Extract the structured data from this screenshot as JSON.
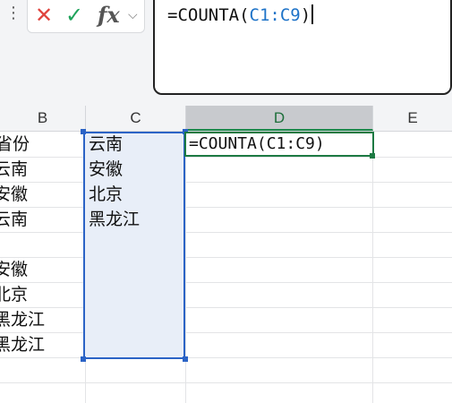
{
  "formula_bar": {
    "formula_prefix": "=COUNTA(",
    "formula_ref": "C1:C9",
    "formula_suffix": ")",
    "icons": [
      "more-icon",
      "cancel-icon",
      "enter-icon",
      "fx-icon",
      "chevron-down-icon"
    ]
  },
  "columns": [
    "B",
    "C",
    "D",
    "E"
  ],
  "column_b": [
    "省份",
    "云南",
    "安徽",
    "云南",
    "",
    "安徽",
    "北京",
    "黑龙江",
    "黑龙江"
  ],
  "column_c": [
    "云南",
    "安徽",
    "北京",
    "黑龙江",
    "",
    "",
    "",
    "",
    ""
  ],
  "active_cell": {
    "column": "D",
    "row": 1,
    "content": "=COUNTA(C1:C9)"
  },
  "colors": {
    "selection_border": "#2b63c6",
    "selection_fill": "#e8eef8",
    "active_border": "#1d7a43",
    "formula_ref": "#1e73c8",
    "cancel": "#e0443e",
    "enter": "#1fa35b"
  }
}
